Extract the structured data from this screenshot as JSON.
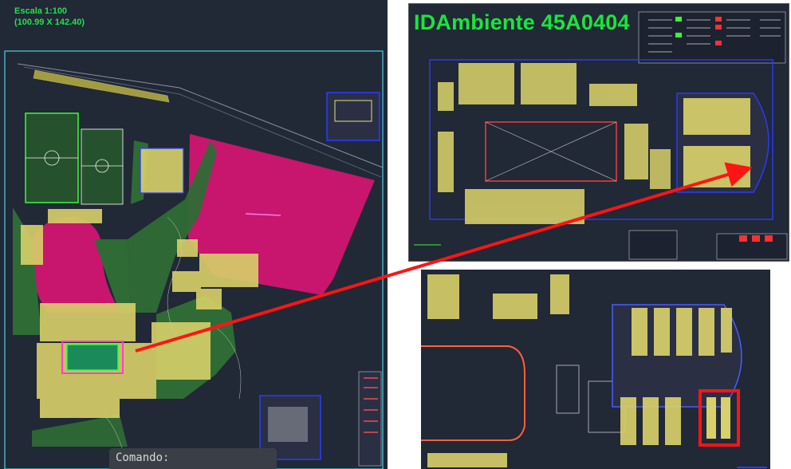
{
  "left_view": {
    "scale_line1": "Escala 1:100",
    "scale_line2": "(100.99 X 142.40)",
    "command_label": "Comando:"
  },
  "top_right_view": {
    "title": "IDAmbiente 45A0404"
  },
  "colors": {
    "background": "#212836",
    "magenta": "#c8166e",
    "green_zone": "#2f6b35",
    "highlight_red": "#ff1414",
    "cad_yellow": "#e8e07a",
    "cad_blue": "#2a3cff"
  },
  "annotation": {
    "arrow": "red pointer from left site plan to room in detail view"
  }
}
